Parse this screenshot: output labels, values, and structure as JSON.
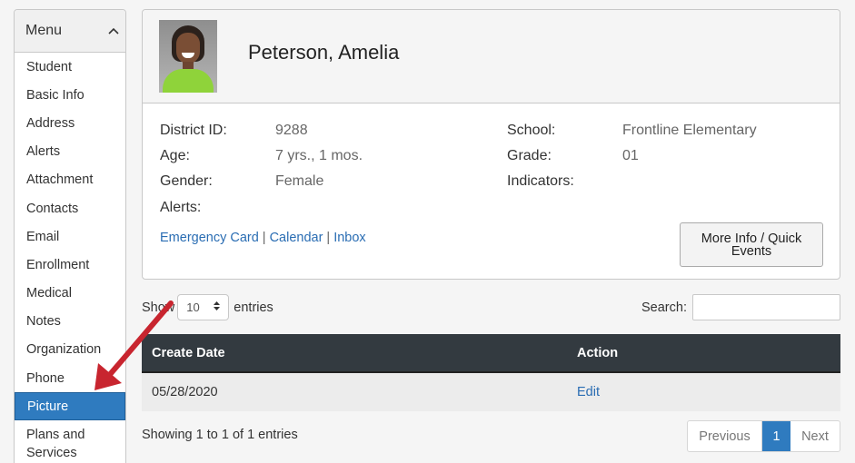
{
  "sidebar": {
    "title": "Menu",
    "collapse_icon": "chevron-up-icon",
    "items": [
      {
        "label": "Student"
      },
      {
        "label": "Basic Info"
      },
      {
        "label": "Address"
      },
      {
        "label": "Alerts"
      },
      {
        "label": "Attachment"
      },
      {
        "label": "Contacts"
      },
      {
        "label": "Email"
      },
      {
        "label": "Enrollment"
      },
      {
        "label": "Medical"
      },
      {
        "label": "Notes"
      },
      {
        "label": "Organization"
      },
      {
        "label": "Phone"
      },
      {
        "label": "Picture",
        "active": true
      },
      {
        "label_line1": "Plans and",
        "label_line2": "Services"
      }
    ]
  },
  "student": {
    "name": "Peterson, Amelia",
    "district_id_label": "District ID:",
    "district_id": "9288",
    "age_label": "Age:",
    "age": "7 yrs., 1 mos.",
    "gender_label": "Gender:",
    "gender": "Female",
    "alerts_label": "Alerts:",
    "school_label": "School:",
    "school": "Frontline Elementary",
    "grade_label": "Grade:",
    "grade": "01",
    "indicators_label": "Indicators:",
    "links": {
      "emergency": "Emergency Card",
      "calendar": "Calendar",
      "inbox": "Inbox",
      "separator": "|"
    },
    "more_button_line1": "More Info / Quick",
    "more_button_line2": "Events"
  },
  "table_controls": {
    "show_label": "Show",
    "page_length": "10",
    "entries_label": "entries",
    "search_label": "Search:",
    "search_value": ""
  },
  "table": {
    "columns": [
      "Create Date",
      "Action"
    ],
    "rows": [
      {
        "create_date": "05/28/2020",
        "action": "Edit"
      }
    ]
  },
  "footer": {
    "showing": "Showing 1 to 1 of 1 entries",
    "previous": "Previous",
    "current_page": "1",
    "next": "Next"
  },
  "colors": {
    "active_item": "#2f7bbf",
    "table_header": "#333a40",
    "link": "#2a6db3",
    "annotation_arrow": "#c8252f"
  }
}
